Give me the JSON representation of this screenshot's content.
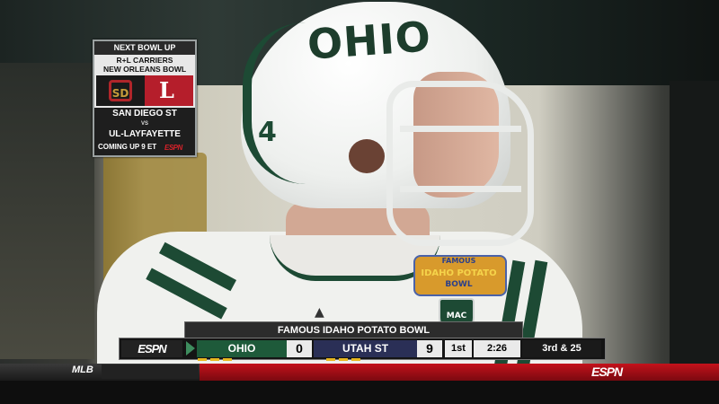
{
  "next_bowl": {
    "heading": "NEXT BOWL UP",
    "bowl_line1": "R+L CARRIERS",
    "bowl_line2": "NEW ORLEANS BOWL",
    "team1": "SAN DIEGO ST",
    "vs": "VS",
    "team2": "UL-LAYFAYETTE",
    "coming_up": "COMING UP 9 ET",
    "network_mark": "ESPN"
  },
  "helmet": {
    "wordmark": "OHIO",
    "number": "4"
  },
  "patch": {
    "line1": "FAMOUS",
    "line2": "IDAHO POTATO",
    "line3": "BOWL",
    "conference": "MAC"
  },
  "scorebug": {
    "bowl_name": "FAMOUS IDAHO POTATO BOWL",
    "network": "ESPN",
    "team1": {
      "name": "OHIO",
      "score": "0",
      "color": "#1e5a3a"
    },
    "team2": {
      "name": "UTAH ST",
      "score": "9",
      "color": "#2a2f56"
    },
    "quarter": "1st",
    "clock": "2:26",
    "down_distance": "3rd & 25"
  },
  "ticker": {
    "league": "MLB",
    "network": "ESPN",
    "accent_color": "#c4121b"
  }
}
